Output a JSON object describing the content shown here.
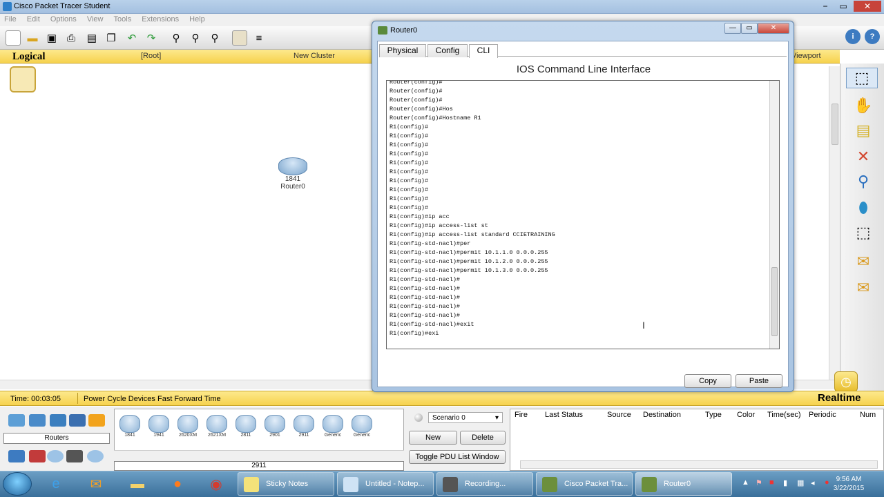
{
  "app": {
    "title": "Cisco Packet Tracer Student",
    "logo_icon": "packet-tracer-icon"
  },
  "window_controls": [
    "−",
    "▭",
    "✕"
  ],
  "menu": [
    "File",
    "Edit",
    "Options",
    "View",
    "Tools",
    "Extensions",
    "Help"
  ],
  "workspace": {
    "mode": "Logical",
    "root": "[Root]",
    "cluster": "New Cluster",
    "viewport": "Viewport"
  },
  "canvas_device": {
    "model": "1841",
    "name": "Router0"
  },
  "timebar": {
    "time": "Time: 00:03:05",
    "controls": "Power Cycle Devices  Fast Forward Time",
    "mode": "Realtime"
  },
  "device_panel": {
    "category_label": "Routers",
    "devices": [
      "1841",
      "1941",
      "2620XM",
      "2621XM",
      "2811",
      "2901",
      "2911",
      "Generic",
      "Generic"
    ],
    "selected_model": "2911"
  },
  "scenario": {
    "selected": "Scenario 0",
    "new_label": "New",
    "delete_label": "Delete",
    "toggle_label": "Toggle PDU List Window"
  },
  "pdu_columns": [
    "Fire",
    "Last Status",
    "Source",
    "Destination",
    "Type",
    "Color",
    "Time(sec)",
    "Periodic",
    "Num"
  ],
  "dialog": {
    "title": "Router0",
    "tabs": [
      "Physical",
      "Config",
      "CLI"
    ],
    "active_tab": "CLI",
    "header": "IOS Command Line Interface",
    "copy_label": "Copy",
    "paste_label": "Paste",
    "terminal_lines": [
      "Router(config)#",
      "Router(config)#",
      "Router(config)#",
      "Router(config)#Hos",
      "Router(config)#Hostname R1",
      "R1(config)#",
      "R1(config)#",
      "R1(config)#",
      "R1(config)#",
      "R1(config)#",
      "R1(config)#",
      "R1(config)#",
      "R1(config)#",
      "R1(config)#",
      "R1(config)#",
      "R1(config)#ip acc",
      "R1(config)#ip access-list st",
      "R1(config)#ip access-list standard CCIETRAINING",
      "R1(config-std-nacl)#per",
      "R1(config-std-nacl)#permit 10.1.1.0 0.0.0.255",
      "R1(config-std-nacl)#permit 10.1.2.0 0.0.0.255",
      "R1(config-std-nacl)#permit 10.1.3.0 0.0.0.255",
      "R1(config-std-nacl)#",
      "R1(config-std-nacl)#",
      "R1(config-std-nacl)#",
      "R1(config-std-nacl)#",
      "R1(config-std-nacl)#",
      "R1(config-std-nacl)#exit",
      "R1(config)#exi"
    ]
  },
  "taskbar": {
    "tasks": [
      "Sticky Notes",
      "Untitled - Notep...",
      "Recording...",
      "Cisco Packet Tra...",
      "Router0"
    ],
    "time": "9:56 AM",
    "date": "3/22/2015"
  },
  "colors": {
    "accent_yellow": "#f6d24e",
    "title_blue": "#a4c0e0",
    "taskbar": "#3a6f9a"
  }
}
